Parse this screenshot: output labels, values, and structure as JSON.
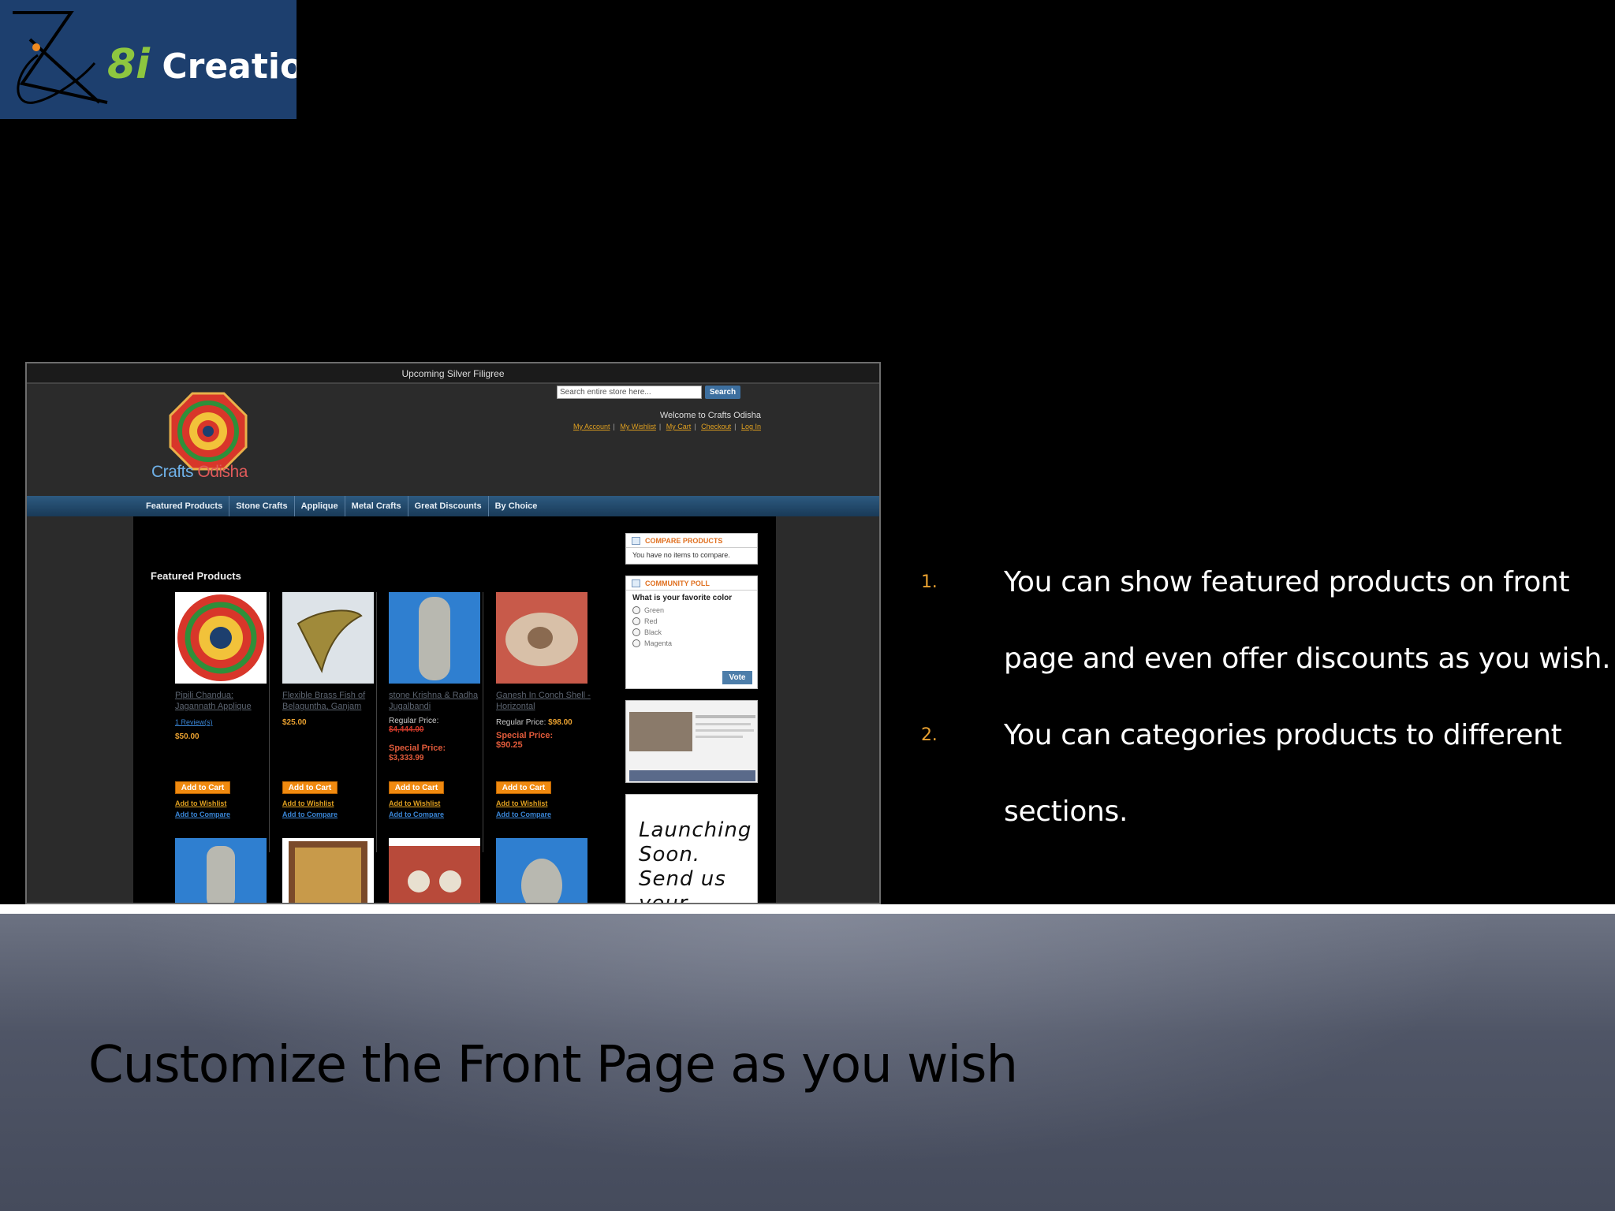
{
  "brand": {
    "logo_number": "8i",
    "logo_word": "Creations"
  },
  "site": {
    "top_banner": "Upcoming Silver Filigree",
    "search_placeholder": "Search entire store here...",
    "search_button": "Search",
    "welcome": "Welcome to Crafts Odisha",
    "account_links": [
      "My Account",
      "My Wishlist",
      "My Cart",
      "Checkout",
      "Log In"
    ],
    "logo_text_a": "Crafts",
    "logo_text_b": "Odisha",
    "nav": [
      "Featured Products",
      "Stone Crafts",
      "Applique",
      "Metal Crafts",
      "Great Discounts",
      "By Choice"
    ],
    "featured_title": "Featured Products",
    "products": [
      {
        "name": "Pipili Chandua: Jagannath Applique",
        "reviews": "1 Review(s)",
        "price": "$50.00"
      },
      {
        "name": "Flexible Brass Fish of Belaguntha, Ganjam",
        "price": "$25.00"
      },
      {
        "name": "stone Krishna & Radha Jugalbandi",
        "regular_label": "Regular Price:",
        "regular_price": "$4,444.00",
        "special_label": "Special Price:",
        "special_price": "$3,333.99"
      },
      {
        "name": "Ganesh In Conch Shell - Horizontal",
        "regular_label": "Regular Price:",
        "regular_price": "$98.00",
        "special_label": "Special Price:",
        "special_price": "$90.25"
      }
    ],
    "add_to_cart": "Add to Cart",
    "add_to_wishlist": "Add to Wishlist",
    "add_to_compare": "Add to Compare",
    "compare_widget": {
      "title": "COMPARE PRODUCTS",
      "text": "You have no items to compare."
    },
    "poll_widget": {
      "title": "COMMUNITY POLL",
      "question": "What is your favorite color",
      "options": [
        "Green",
        "Red",
        "Black",
        "Magenta"
      ],
      "vote": "Vote"
    },
    "launching_text": "Launching Soon. Send us your feedback"
  },
  "bullets": [
    {
      "num": "1.",
      "text": "You can show featured products on front page and even offer discounts as you wish."
    },
    {
      "num": "2.",
      "text": "You can categories products to different sections."
    }
  ],
  "slide_title": "Customize the Front Page as you wish",
  "colors": {
    "brand_bg": "#1d3f6e",
    "brand_accent": "#8dc63f",
    "bullet_number": "#e8a030",
    "title_band": "#4f5566"
  }
}
